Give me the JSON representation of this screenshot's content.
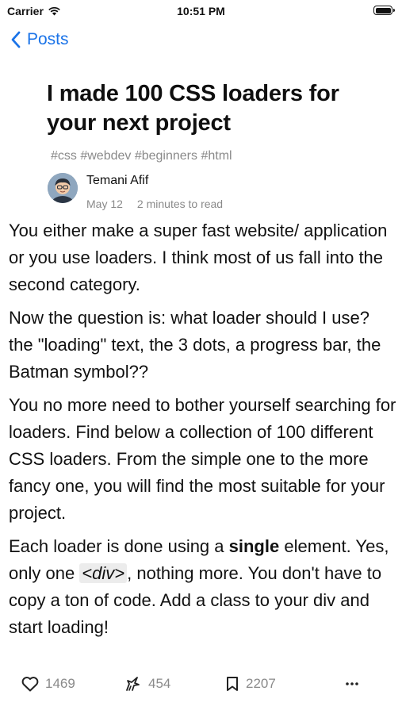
{
  "status_bar": {
    "carrier": "Carrier",
    "time": "10:51 PM",
    "wifi_icon": "wifi-icon",
    "battery_icon": "battery-icon"
  },
  "nav": {
    "back_label": "Posts",
    "back_icon": "chevron-left-icon",
    "accent_color": "#1a73e8"
  },
  "article": {
    "title": "I made 100 CSS loaders for your next project",
    "tags": "#css #webdev #beginners #html",
    "author": "Temani Afif",
    "date": "May 12",
    "read_time": "2 minutes to read",
    "paragraphs": {
      "p1": "You either make a super fast website/ application or you use loaders. I think most of us fall into the second category.",
      "p2": "Now the question is: what loader should I use? the \"loading\" text, the 3 dots, a progress bar, the Batman symbol??",
      "p3": "You no more need to bother yourself searching for loaders. Find below a collection of 100 different CSS loaders. From the simple one to the more fancy one, you will find the most suitable for your project.",
      "p4": {
        "a": "Each loader is done using a ",
        "b": "single",
        "c": " element. Yes, only one ",
        "d": "<div>",
        "e": ", nothing more. You don't have to copy a ton of code. Add a class to your div and start loading!"
      }
    }
  },
  "actions": {
    "likes": "1469",
    "unicorns": "454",
    "bookmarks": "2207",
    "like_icon": "heart-icon",
    "unicorn_icon": "unicorn-icon",
    "bookmark_icon": "bookmark-icon",
    "more_icon": "more-icon"
  }
}
